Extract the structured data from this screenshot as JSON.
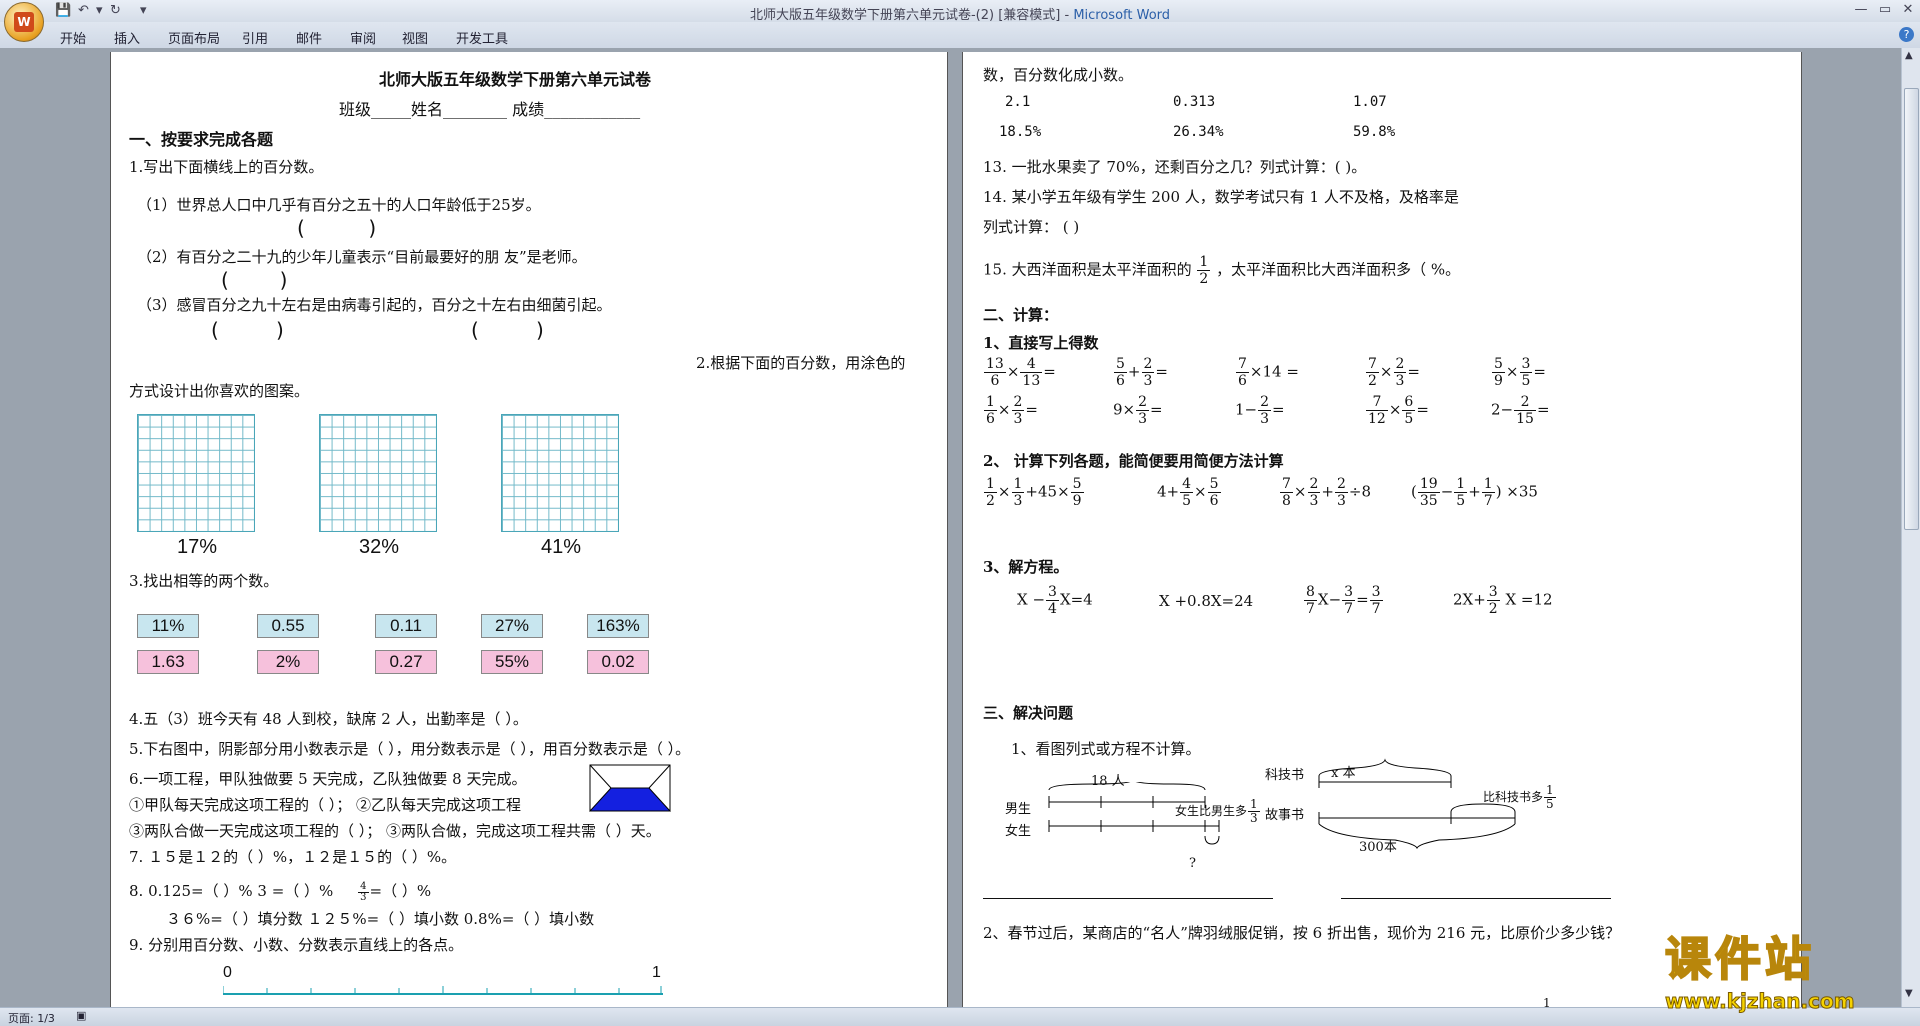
{
  "window": {
    "title": "北师大版五年级数学下册第六单元试卷-(2) [兼容模式] - ",
    "app": "Microsoft Word",
    "office_button": "W"
  },
  "ribbon_tabs": [
    "开始",
    "插入",
    "页面布局",
    "引用",
    "邮件",
    "审阅",
    "视图",
    "开发工具"
  ],
  "status": {
    "page": "页面: 1/3"
  },
  "watermark": {
    "name": "课件站",
    "url": "www.kjzhan.com"
  },
  "page1": {
    "title": "北师大版五年级数学下册第六单元试卷",
    "info": "班级_____姓名________       成绩____________",
    "sec1": "一、按要求完成各题",
    "q1": "1.写出下面横线上的百分数。",
    "q1a": "（1）世界总人口中几乎有百分之五十的人口年龄低于25岁。",
    "q1b": "（2）有百分之二十九的少年儿童表示“目前最要好的朋 友”是老师。",
    "q1c": "（3）感冒百分之九十左右是由病毒引起的，百分之十左右由细菌引起。",
    "q2a": "2.根据下面的百分数，用涂色的",
    "q2b": "方式设计出你喜欢的图案。",
    "grid_labels": [
      "17%",
      "32%",
      "41%"
    ],
    "q3": "3.找出相等的两个数。",
    "cards_top": [
      "11%",
      "0.55",
      "0.11",
      "27%",
      "163%"
    ],
    "cards_bottom": [
      "1.63",
      "2%",
      "0.27",
      "55%",
      "0.02"
    ],
    "q4": "4.五（3）班今天有 48 人到校，缺席 2 人，出勤率是（    ）。",
    "q5": "5.下右图中，阴影部分用小数表示是（     ），用分数表示是（     ），用百分数表示是（       ）。",
    "q6": "6.一项工程，甲队独做要 5 天完成，乙队独做要 8 天完成。",
    "q6a": "①甲队每天完成这项工程的（     ）；   ②乙队每天完成这项工程",
    "q6b": "③两队合做一天完成这项工程的（      ）；  ③两队合做，完成这项工程共需（  ）天。",
    "q7": "7.   １５是１２的（     ）%，１２是１５的（     ）%。",
    "q8a": "8.    0.125=（    ）%        3 =（  ）%",
    "q8a_tail": "=（  ）%",
    "q8b": "３６%=（  ）填分数       １２５%=（     ）填小数      0.8%=（  ）填小数",
    "q9": "9. 分别用百分数、小数、分数表示直线上的各点。",
    "ruler": [
      "0",
      "1"
    ]
  },
  "page2": {
    "l1": "数，百分数化成小数。",
    "nums1": [
      "2.1",
      "0.313",
      "1.07"
    ],
    "nums2": [
      "18.5%",
      "26.34%",
      "59.8%"
    ],
    "q13": "13. 一批水果卖了 70%，还剩百分之几？列式计算：(                              )。",
    "q14": "14. 某小学五年级有学生 200 人，数学考试只有 1 人不及格，及格率是",
    "q14b": "列式计算：     (                                  )",
    "q15a": "15. 大西洋面积是太平洋面积的",
    "q15b": "，太平洋面积比大西洋面积多（          %。",
    "sec2": "二、计算：",
    "s2_1": "1、直接写上得数",
    "s2_2": "2、 计算下列各题，能简便要用简便方法计算",
    "s2_3": "3、解方程。",
    "eq1": "X −",
    "eq1b": "X=4",
    "eq2": "X +0.8X=24",
    "eq4": "2X+",
    "eq4b": " X =12",
    "sec3": "三、解决问题",
    "p1": "1、看图列式或方程不计算。",
    "boys": "男生",
    "girls": "女生",
    "d18": "18 人",
    "girl_more": "女生比男生多",
    "kejishu": "科技书",
    "gushishu": "故事书",
    "xben": "x 本",
    "more_than": "比科技书多",
    "s300": "300本",
    "q": "?",
    "p2": "2、春节过后，某商店的“名人”牌羽绒服促销，按 6 折出售，现价为 216 元，比原价少多少钱？",
    "page_no": "1"
  }
}
